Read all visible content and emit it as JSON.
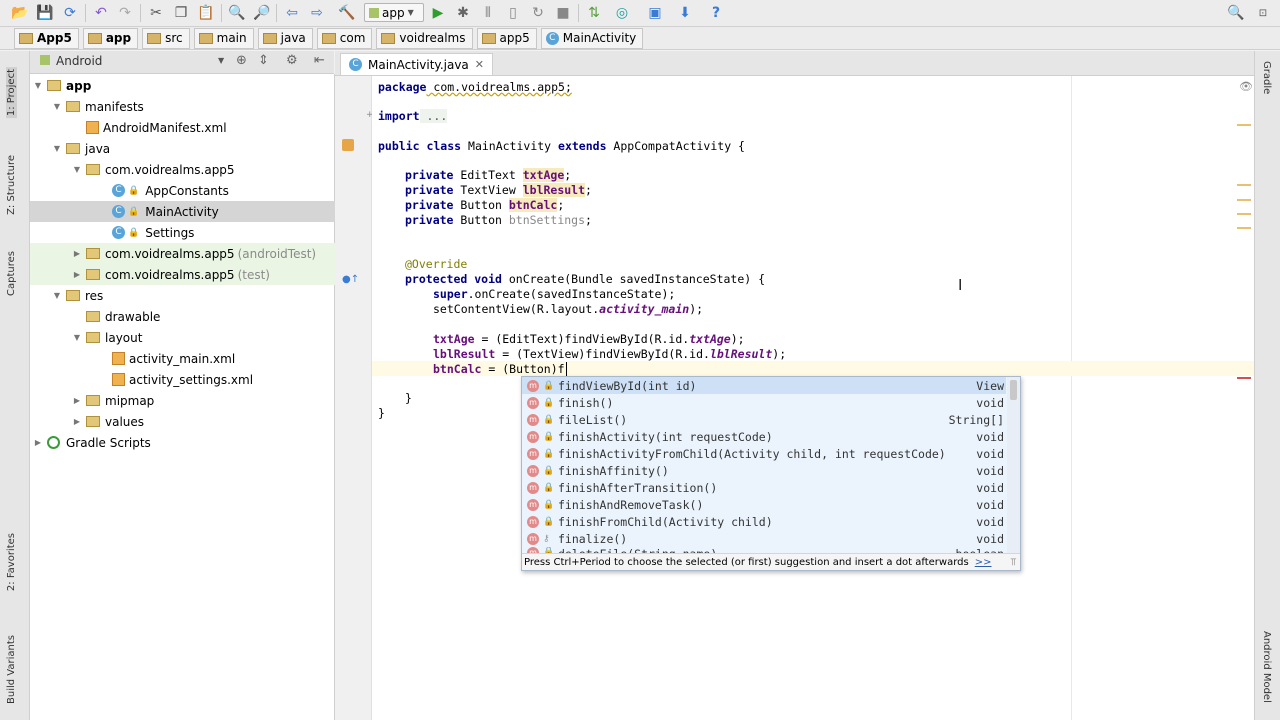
{
  "toolbar": {
    "run_config": "app",
    "icons": [
      "open-icon",
      "save-icon",
      "sync-icon",
      "undo-icon",
      "redo-icon",
      "cut-icon",
      "copy-icon",
      "paste-icon",
      "find-icon",
      "replace-icon",
      "back-icon",
      "forward-icon",
      "make-icon",
      "run-icon",
      "debug-icon",
      "attach-icon",
      "sdk-icon",
      "avd-icon",
      "sync-gradle-icon",
      "structure-icon",
      "monitor-icon",
      "help-icon",
      "search-icon"
    ]
  },
  "breadcrumb": [
    "App5",
    "app",
    "src",
    "main",
    "java",
    "com",
    "voidrealms",
    "app5",
    "MainActivity"
  ],
  "left_strip": {
    "project": "1: Project",
    "structure": "Z: Structure",
    "captures": "Captures",
    "favorites": "2: Favorites",
    "build_variants": "Build Variants"
  },
  "right_strip": {
    "gradle": "Gradle",
    "android_model": "Android Model"
  },
  "project_panel": {
    "view": "Android"
  },
  "tree": [
    {
      "label": "app",
      "suffix": ""
    },
    {
      "label": "manifests",
      "suffix": ""
    },
    {
      "label": "AndroidManifest.xml",
      "suffix": ""
    },
    {
      "label": "java",
      "suffix": ""
    },
    {
      "label": "com.voidrealms.app5",
      "suffix": ""
    },
    {
      "label": "AppConstants",
      "suffix": ""
    },
    {
      "label": "MainActivity",
      "suffix": ""
    },
    {
      "label": "Settings",
      "suffix": ""
    },
    {
      "label": "com.voidrealms.app5",
      "suffix": "(androidTest)"
    },
    {
      "label": "com.voidrealms.app5",
      "suffix": "(test)"
    },
    {
      "label": "res",
      "suffix": ""
    },
    {
      "label": "drawable",
      "suffix": ""
    },
    {
      "label": "layout",
      "suffix": ""
    },
    {
      "label": "activity_main.xml",
      "suffix": ""
    },
    {
      "label": "activity_settings.xml",
      "suffix": ""
    },
    {
      "label": "mipmap",
      "suffix": ""
    },
    {
      "label": "values",
      "suffix": ""
    },
    {
      "label": "Gradle Scripts",
      "suffix": ""
    }
  ],
  "editor": {
    "tab_label": "MainActivity.java",
    "code": {
      "package_kw": "package",
      "package_name": " com.voidrealms.app5;",
      "import_kw": "import",
      "import_rest": " ...",
      "class_kw": "public class",
      "class_name": " MainActivity ",
      "extends_kw": "extends",
      "class_rest": " AppCompatActivity {",
      "f1_kw": "private",
      "f1_type": " EditText ",
      "f1_name": "txtAge",
      "f2_kw": "private",
      "f2_type": " TextView ",
      "f2_name": "lblResult",
      "f3_kw": "private",
      "f3_type": " Button ",
      "f3_name": "btnCalc",
      "f4_kw": "private",
      "f4_type": " Button ",
      "f4_name": "btnSettings",
      "semi": ";",
      "annotation": "@Override",
      "m_kw": "protected void",
      "m_rest": " onCreate(Bundle savedInstanceState) {",
      "super_kw": "super",
      "super_rest": ".onCreate(savedInstanceState);",
      "scv_a": "setContentView(R.layout.",
      "scv_b": "activity_main",
      "scv_c": ");",
      "a1_a": " = (EditText)findViewById(R.id.",
      "a1_b": "txtAge",
      "a1_c": ");",
      "a2_a": " = (TextView)findViewById(R.id.",
      "a2_b": "lblResult",
      "a2_c": ");",
      "a3_a": " = (Button)f",
      "close_method": "}",
      "close_class": "}"
    }
  },
  "completion": {
    "items": [
      {
        "name": "findViewById(int id)",
        "type": "View"
      },
      {
        "name": "finish()",
        "type": "void"
      },
      {
        "name": "fileList()",
        "type": "String[]"
      },
      {
        "name": "finishActivity(int requestCode)",
        "type": "void"
      },
      {
        "name": "finishActivityFromChild(Activity child, int requestCode)",
        "type": "void"
      },
      {
        "name": "finishAffinity()",
        "type": "void"
      },
      {
        "name": "finishAfterTransition()",
        "type": "void"
      },
      {
        "name": "finishAndRemoveTask()",
        "type": "void"
      },
      {
        "name": "finishFromChild(Activity child)",
        "type": "void"
      },
      {
        "name": "finalize()",
        "type": "void"
      },
      {
        "name": "deleteFile(String name)",
        "type": "boolean"
      }
    ],
    "footer": "Press Ctrl+Period to choose the selected (or first) suggestion and insert a dot afterwards",
    "footer_link": ">>"
  },
  "colors": {
    "keyword": "#000080",
    "field": "#660e7a",
    "annotation": "#808000",
    "selection": "#cde0f5"
  }
}
